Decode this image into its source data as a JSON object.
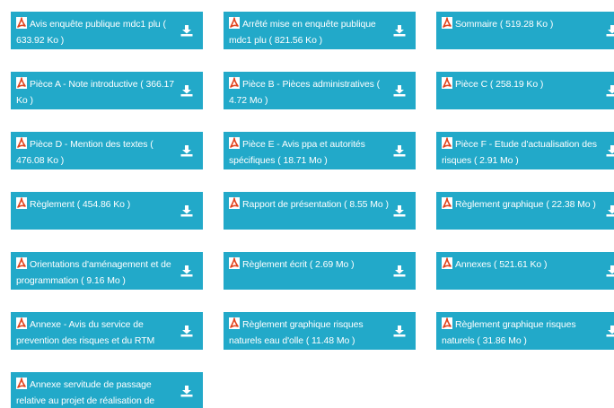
{
  "theme": {
    "accent": "#22a9c9",
    "pdf_icon_color": "#e2431d",
    "text_color": "#ffffff"
  },
  "icons": {
    "file": "pdf-file-icon",
    "action": "download-icon"
  },
  "documents": [
    {
      "label": "Avis enquête publique mdc1 plu ( 633.92 Ko )"
    },
    {
      "label": "Arrêté mise en enquête publique mdc1 plu ( 821.56 Ko )"
    },
    {
      "label": "Sommaire ( 519.28 Ko )"
    },
    {
      "label": "Pièce A - Note introductive ( 366.17 Ko )"
    },
    {
      "label": "Pièce B - Pièces administratives ( 4.72 Mo )"
    },
    {
      "label": "Pièce C ( 258.19 Ko )"
    },
    {
      "label": "Pièce D - Mention des textes ( 476.08 Ko )"
    },
    {
      "label": "Pièce E - Avis ppa et autorités spécifiques ( 18.71 Mo )"
    },
    {
      "label": "Pièce F - Etude d'actualisation des risques ( 2.91 Mo )"
    },
    {
      "label": "Règlement ( 454.86 Ko )"
    },
    {
      "label": "Rapport de présentation ( 8.55 Mo )"
    },
    {
      "label": "Règlement graphique ( 22.38 Mo )"
    },
    {
      "label": "Orientations d'aménagement et de programmation ( 9.16 Mo )"
    },
    {
      "label": "Règlement écrit ( 2.69 Mo )"
    },
    {
      "label": "Annexes ( 521.61 Ko )"
    },
    {
      "label": "Annexe - Avis du service de prevention des risques et du RTM"
    },
    {
      "label": "Règlement graphique risques naturels eau d'olle ( 11.48 Mo )"
    },
    {
      "label": "Règlement graphique risques naturels ( 31.86 Mo )"
    },
    {
      "label": "Annexe servitude de passage relative au projet de réalisation de"
    }
  ]
}
